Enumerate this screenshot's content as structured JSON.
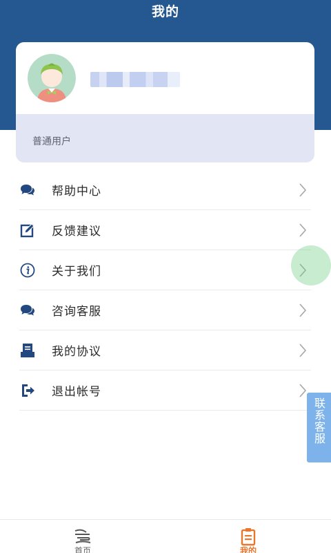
{
  "header": {
    "title": "我的"
  },
  "profile": {
    "level": "普通用户"
  },
  "menu": {
    "items": [
      {
        "label": "帮助中心",
        "icon": "chat-bubble-icon"
      },
      {
        "label": "反馈建议",
        "icon": "edit-icon"
      },
      {
        "label": "关于我们",
        "icon": "info-icon"
      },
      {
        "label": "咨询客服",
        "icon": "chat-bubble-icon"
      },
      {
        "label": "我的协议",
        "icon": "document-icon"
      },
      {
        "label": "退出帐号",
        "icon": "logout-icon"
      }
    ]
  },
  "floating": {
    "contact_label": "联系客服"
  },
  "tabbar": {
    "items": [
      {
        "label": "首页",
        "icon": "home-icon"
      },
      {
        "label": "我的",
        "icon": "clipboard-icon"
      }
    ]
  },
  "colors": {
    "header": "#255790",
    "icon": "#23487f",
    "active_tab": "#e8772d",
    "contact_button": "#7db3ea",
    "card_bottom": "#e1e5f4"
  }
}
